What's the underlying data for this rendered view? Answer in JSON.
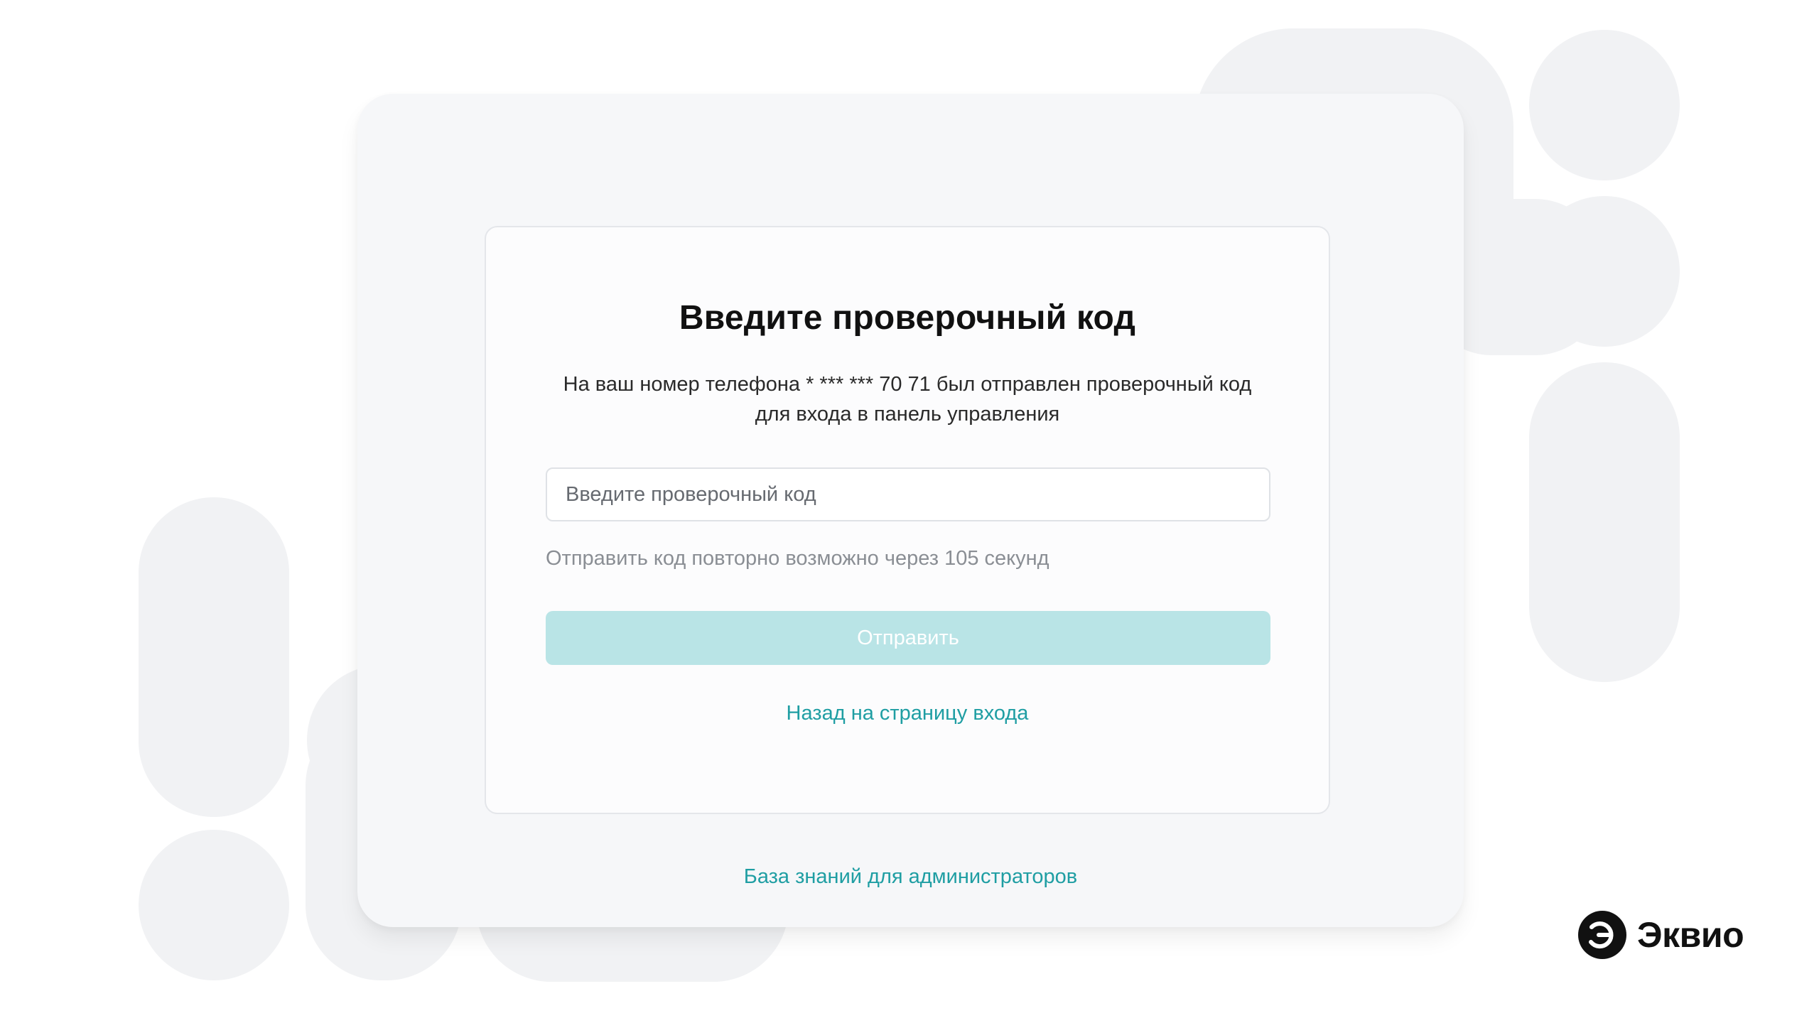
{
  "theme": {
    "accent": "#1f9ea3",
    "button_disabled_bg": "#b9e4e6",
    "panel_bg": "#f6f7f9",
    "card_bg": "#fcfcfd",
    "shape_color": "#f1f2f4"
  },
  "card": {
    "title": "Введите проверочный код",
    "subtitle_line1": "На ваш номер телефона * *** *** 70 71 был отправлен проверочный код",
    "subtitle_line2": "для входа в панель управления",
    "code_input": {
      "placeholder": "Введите проверочный код",
      "value": ""
    },
    "resend_hint": "Отправить код повторно возможно через 105 секунд",
    "submit_label": "Отправить",
    "submit_disabled": true,
    "back_link": "Назад на страницу входа"
  },
  "footer": {
    "knowledge_base_link": "База знаний для администраторов"
  },
  "brand": {
    "name": "Эквио",
    "icon": "ekvio-logo-icon"
  }
}
